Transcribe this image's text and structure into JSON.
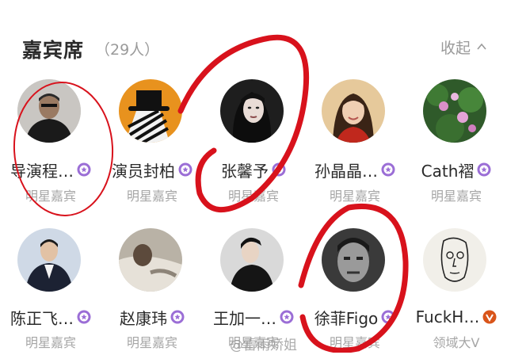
{
  "section": {
    "title": "嘉宾席",
    "count": "（29人）",
    "collapse_label": "收起",
    "collapse_icon": "chevron-up-icon"
  },
  "colors": {
    "verified_badge": "#9b6ed6",
    "field_badge": "#d9551a",
    "annotation_red": "#d8121c"
  },
  "guests": [
    {
      "name": "导演程…",
      "role": "明星嘉宾",
      "badge": "verified-purple-icon",
      "avatar": "man-dark-jacket-avatar"
    },
    {
      "name": "演员封柏",
      "role": "明星嘉宾",
      "badge": "verified-purple-icon",
      "avatar": "zebra-top-hat-avatar"
    },
    {
      "name": "张馨予",
      "role": "明星嘉宾",
      "badge": "verified-purple-icon",
      "avatar": "woman-portrait-avatar"
    },
    {
      "name": "孙晶晶…",
      "role": "明星嘉宾",
      "badge": "verified-purple-icon",
      "avatar": "woman-smiling-avatar"
    },
    {
      "name": "Cath褶",
      "role": "明星嘉宾",
      "badge": "verified-purple-icon",
      "avatar": "lotus-flowers-avatar"
    },
    {
      "name": "陈正飞…",
      "role": "明星嘉宾",
      "badge": "verified-purple-icon",
      "avatar": "man-suit-avatar"
    },
    {
      "name": "赵康玮",
      "role": "明星嘉宾",
      "badge": "verified-purple-icon",
      "avatar": "blurry-photo-avatar"
    },
    {
      "name": "王加一…",
      "role": "明星嘉宾",
      "badge": "verified-purple-icon",
      "avatar": "man-black-outfit-avatar"
    },
    {
      "name": "徐菲Figo",
      "role": "明星嘉宾",
      "badge": "verified-purple-icon",
      "avatar": "man-grayscale-avatar"
    },
    {
      "name": "FuckH…",
      "role": "领域大V",
      "badge": "verified-orange-icon",
      "avatar": "sketch-face-avatar"
    }
  ],
  "watermark": "@雷雨娇姐"
}
